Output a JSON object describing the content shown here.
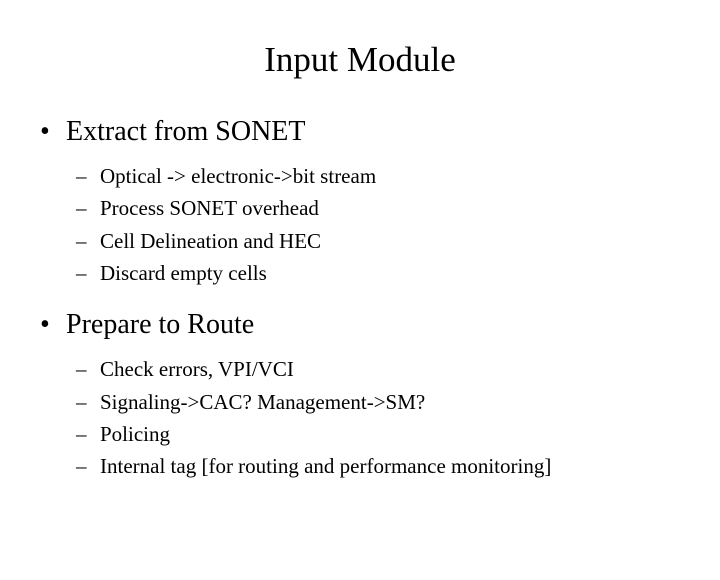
{
  "slide": {
    "title": "Input Module",
    "sections": [
      {
        "heading": "Extract from SONET",
        "items": [
          "Optical -> electronic->bit stream",
          "Process SONET overhead",
          "Cell Delineation and HEC",
          "Discard empty cells"
        ]
      },
      {
        "heading": "Prepare to Route",
        "items": [
          "Check errors, VPI/VCI",
          "Signaling->CAC? Management->SM?",
          "Policing",
          "Internal tag [for routing and performance monitoring]"
        ]
      }
    ]
  }
}
